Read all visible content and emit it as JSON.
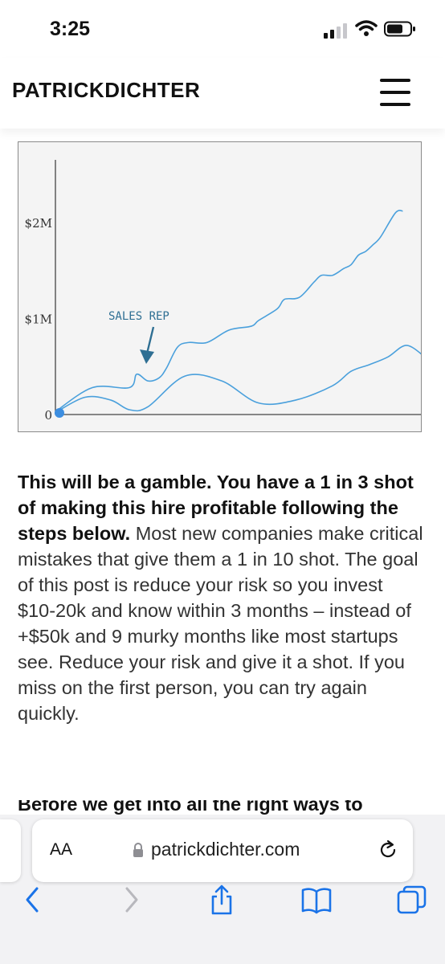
{
  "status_bar": {
    "time": "3:25"
  },
  "site": {
    "brand": "PATRICKDICHTER"
  },
  "chart_data": {
    "type": "line",
    "y_tick_labels": [
      "0",
      "$1M",
      "$2M"
    ],
    "ylim": [
      0,
      2.2
    ],
    "xlim": [
      0,
      100
    ],
    "annotation": "SALES REP",
    "grid": false,
    "series": [
      {
        "x": [
          0,
          10,
          20,
          22,
          25,
          28,
          30,
          33,
          36,
          41,
          47,
          53,
          55,
          60,
          62,
          66,
          70,
          72,
          75,
          78,
          80,
          82,
          84,
          86,
          88,
          92,
          94
        ],
        "values": [
          0.03,
          0.28,
          0.28,
          0.42,
          0.35,
          0.38,
          0.48,
          0.7,
          0.75,
          0.75,
          0.88,
          0.92,
          0.98,
          1.1,
          1.2,
          1.22,
          1.38,
          1.45,
          1.45,
          1.52,
          1.56,
          1.66,
          1.7,
          1.77,
          1.85,
          2.1,
          2.12
        ]
      },
      {
        "x": [
          0,
          8,
          15,
          20,
          25,
          35,
          45,
          55,
          65,
          75,
          80,
          85,
          90,
          95,
          100
        ],
        "values": [
          0.02,
          0.18,
          0.15,
          0.05,
          0.08,
          0.4,
          0.35,
          0.12,
          0.15,
          0.3,
          0.45,
          0.52,
          0.6,
          0.72,
          0.6
        ]
      }
    ]
  },
  "article": {
    "bold_text": "This will be a gamble. You have a 1 in 3 shot of making this hire profitable following the steps below.",
    "body_text": " Most new companies make critical mistakes that give them a 1 in 10 shot. The goal of this post is reduce your risk so you invest $10-20k and know within 3 months – instead of +$50k and 9 murky months like most startups see. Reduce your risk and give it a shot. If you miss on the first person, you can try again quickly.",
    "next_heading": "Before we get into all the right ways to"
  },
  "browser": {
    "text_size_label": "AA",
    "url": "patrickdichter.com",
    "icons": [
      "lock-icon",
      "reload-icon",
      "back-icon",
      "forward-icon",
      "share-icon",
      "bookmarks-icon",
      "tabs-icon"
    ]
  }
}
